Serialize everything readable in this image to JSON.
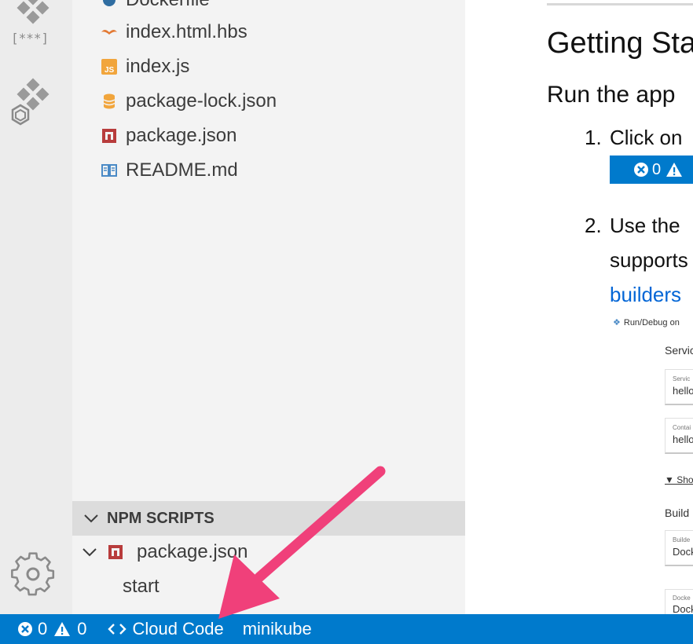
{
  "explorer": {
    "files": [
      {
        "name": "Dockerfile",
        "icon": "docker-icon"
      },
      {
        "name": "index.html.hbs",
        "icon": "handlebars-icon"
      },
      {
        "name": "index.js",
        "icon": "javascript-file-icon"
      },
      {
        "name": "package-lock.json",
        "icon": "database-icon"
      },
      {
        "name": "package.json",
        "icon": "npm-icon"
      },
      {
        "name": "README.md",
        "icon": "book-icon"
      }
    ],
    "js_badge": "JS"
  },
  "activity_bar": {
    "json_badge": "[***]"
  },
  "npm_scripts": {
    "title": "NPM SCRIPTS",
    "package": "package.json",
    "script": "start"
  },
  "preview": {
    "heading": "Getting Sta",
    "subheading": "Run the app",
    "step1_number": "1.",
    "step1_text": "Click on",
    "step1_errors": "0",
    "step2_number": "2.",
    "step2_text": "Use the",
    "step2_line2": "supports",
    "step2_link": "builders",
    "img_title": "Run/Debug on",
    "img_service_section": "Servic",
    "img_service_label": "Servic",
    "img_service_value": "hello",
    "img_container_label": "Contai",
    "img_container_value": "hello",
    "img_show": "▼ Sho",
    "img_build_section": "Build",
    "img_builder_label": "Builde",
    "img_builder_value": "Dock",
    "img_docker_label": "Docke",
    "img_docker_value": "Dock"
  },
  "status_bar": {
    "errors": "0",
    "warnings": "0",
    "cloud_code": "Cloud Code",
    "cluster": "minikube"
  },
  "colors": {
    "status_bar": "#007acc",
    "annotation_arrow": "#f0407a"
  }
}
